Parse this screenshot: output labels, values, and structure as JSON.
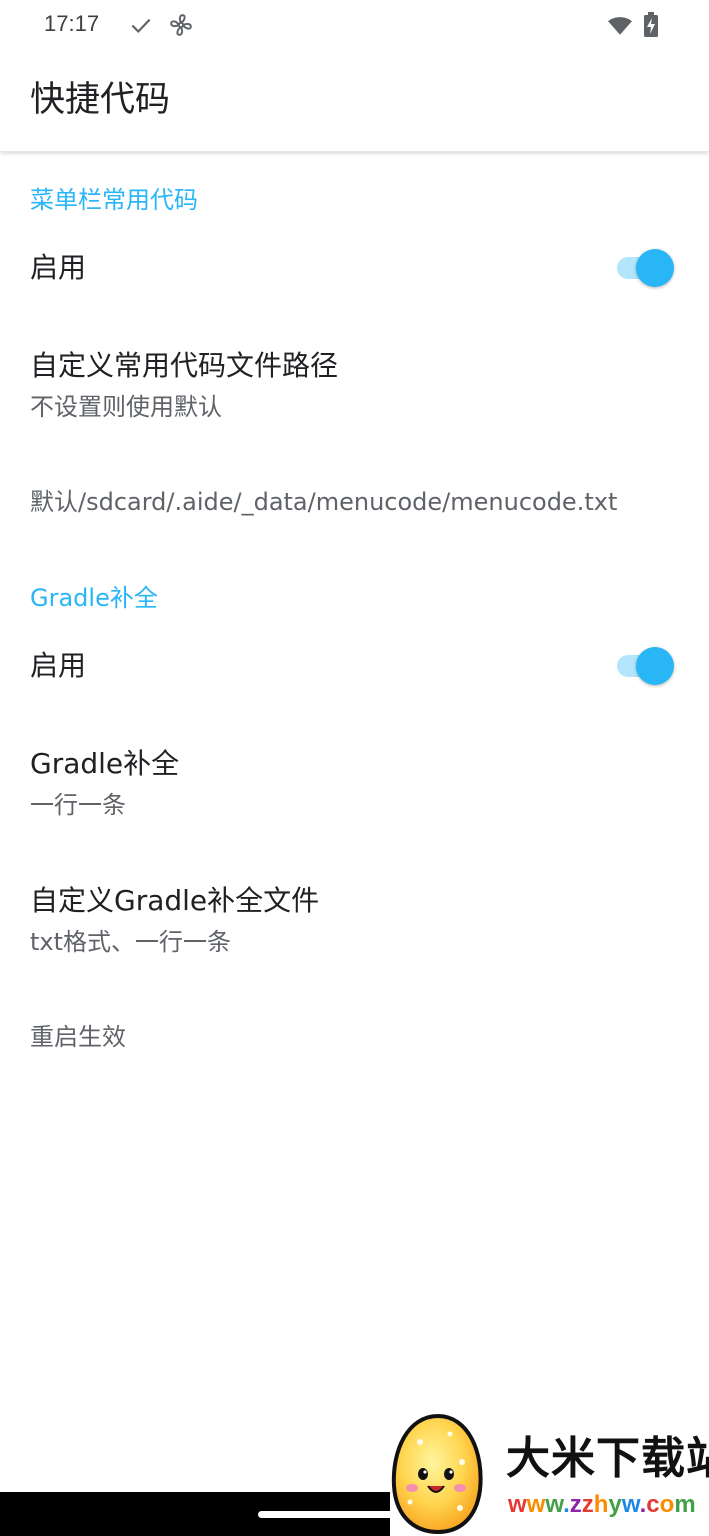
{
  "status_bar": {
    "time": "17:17",
    "icons": [
      "check-icon",
      "fan-icon",
      "wifi-icon",
      "battery-charging-icon"
    ]
  },
  "app_bar": {
    "title": "快捷代码"
  },
  "sections": [
    {
      "category": "菜单栏常用代码",
      "enable": {
        "title": "启用",
        "checked": true
      },
      "custom_path": {
        "title": "自定义常用代码文件路径",
        "summary": "不设置则使用默认"
      },
      "default_path": "默认/sdcard/.aide/_data/menucode/menucode.txt"
    },
    {
      "category": "Gradle补全",
      "enable": {
        "title": "启用",
        "checked": true
      },
      "completion": {
        "title": "Gradle补全",
        "summary": "一行一条"
      },
      "custom_file": {
        "title": "自定义Gradle补全文件",
        "summary": "txt格式、一行一条"
      },
      "restart_note": "重启生效"
    }
  ],
  "watermark": {
    "title": "大米下载站",
    "url": "www.zzhyw.com",
    "url_colors": [
      "#e53935",
      "#fb8c00",
      "#43a047",
      "#1e88e5",
      "#8e24aa"
    ]
  },
  "colors": {
    "accent": "#29b6f6",
    "accent_light": "#b3e5fc",
    "title_text": "#202124",
    "summary_text": "#5f6368"
  }
}
